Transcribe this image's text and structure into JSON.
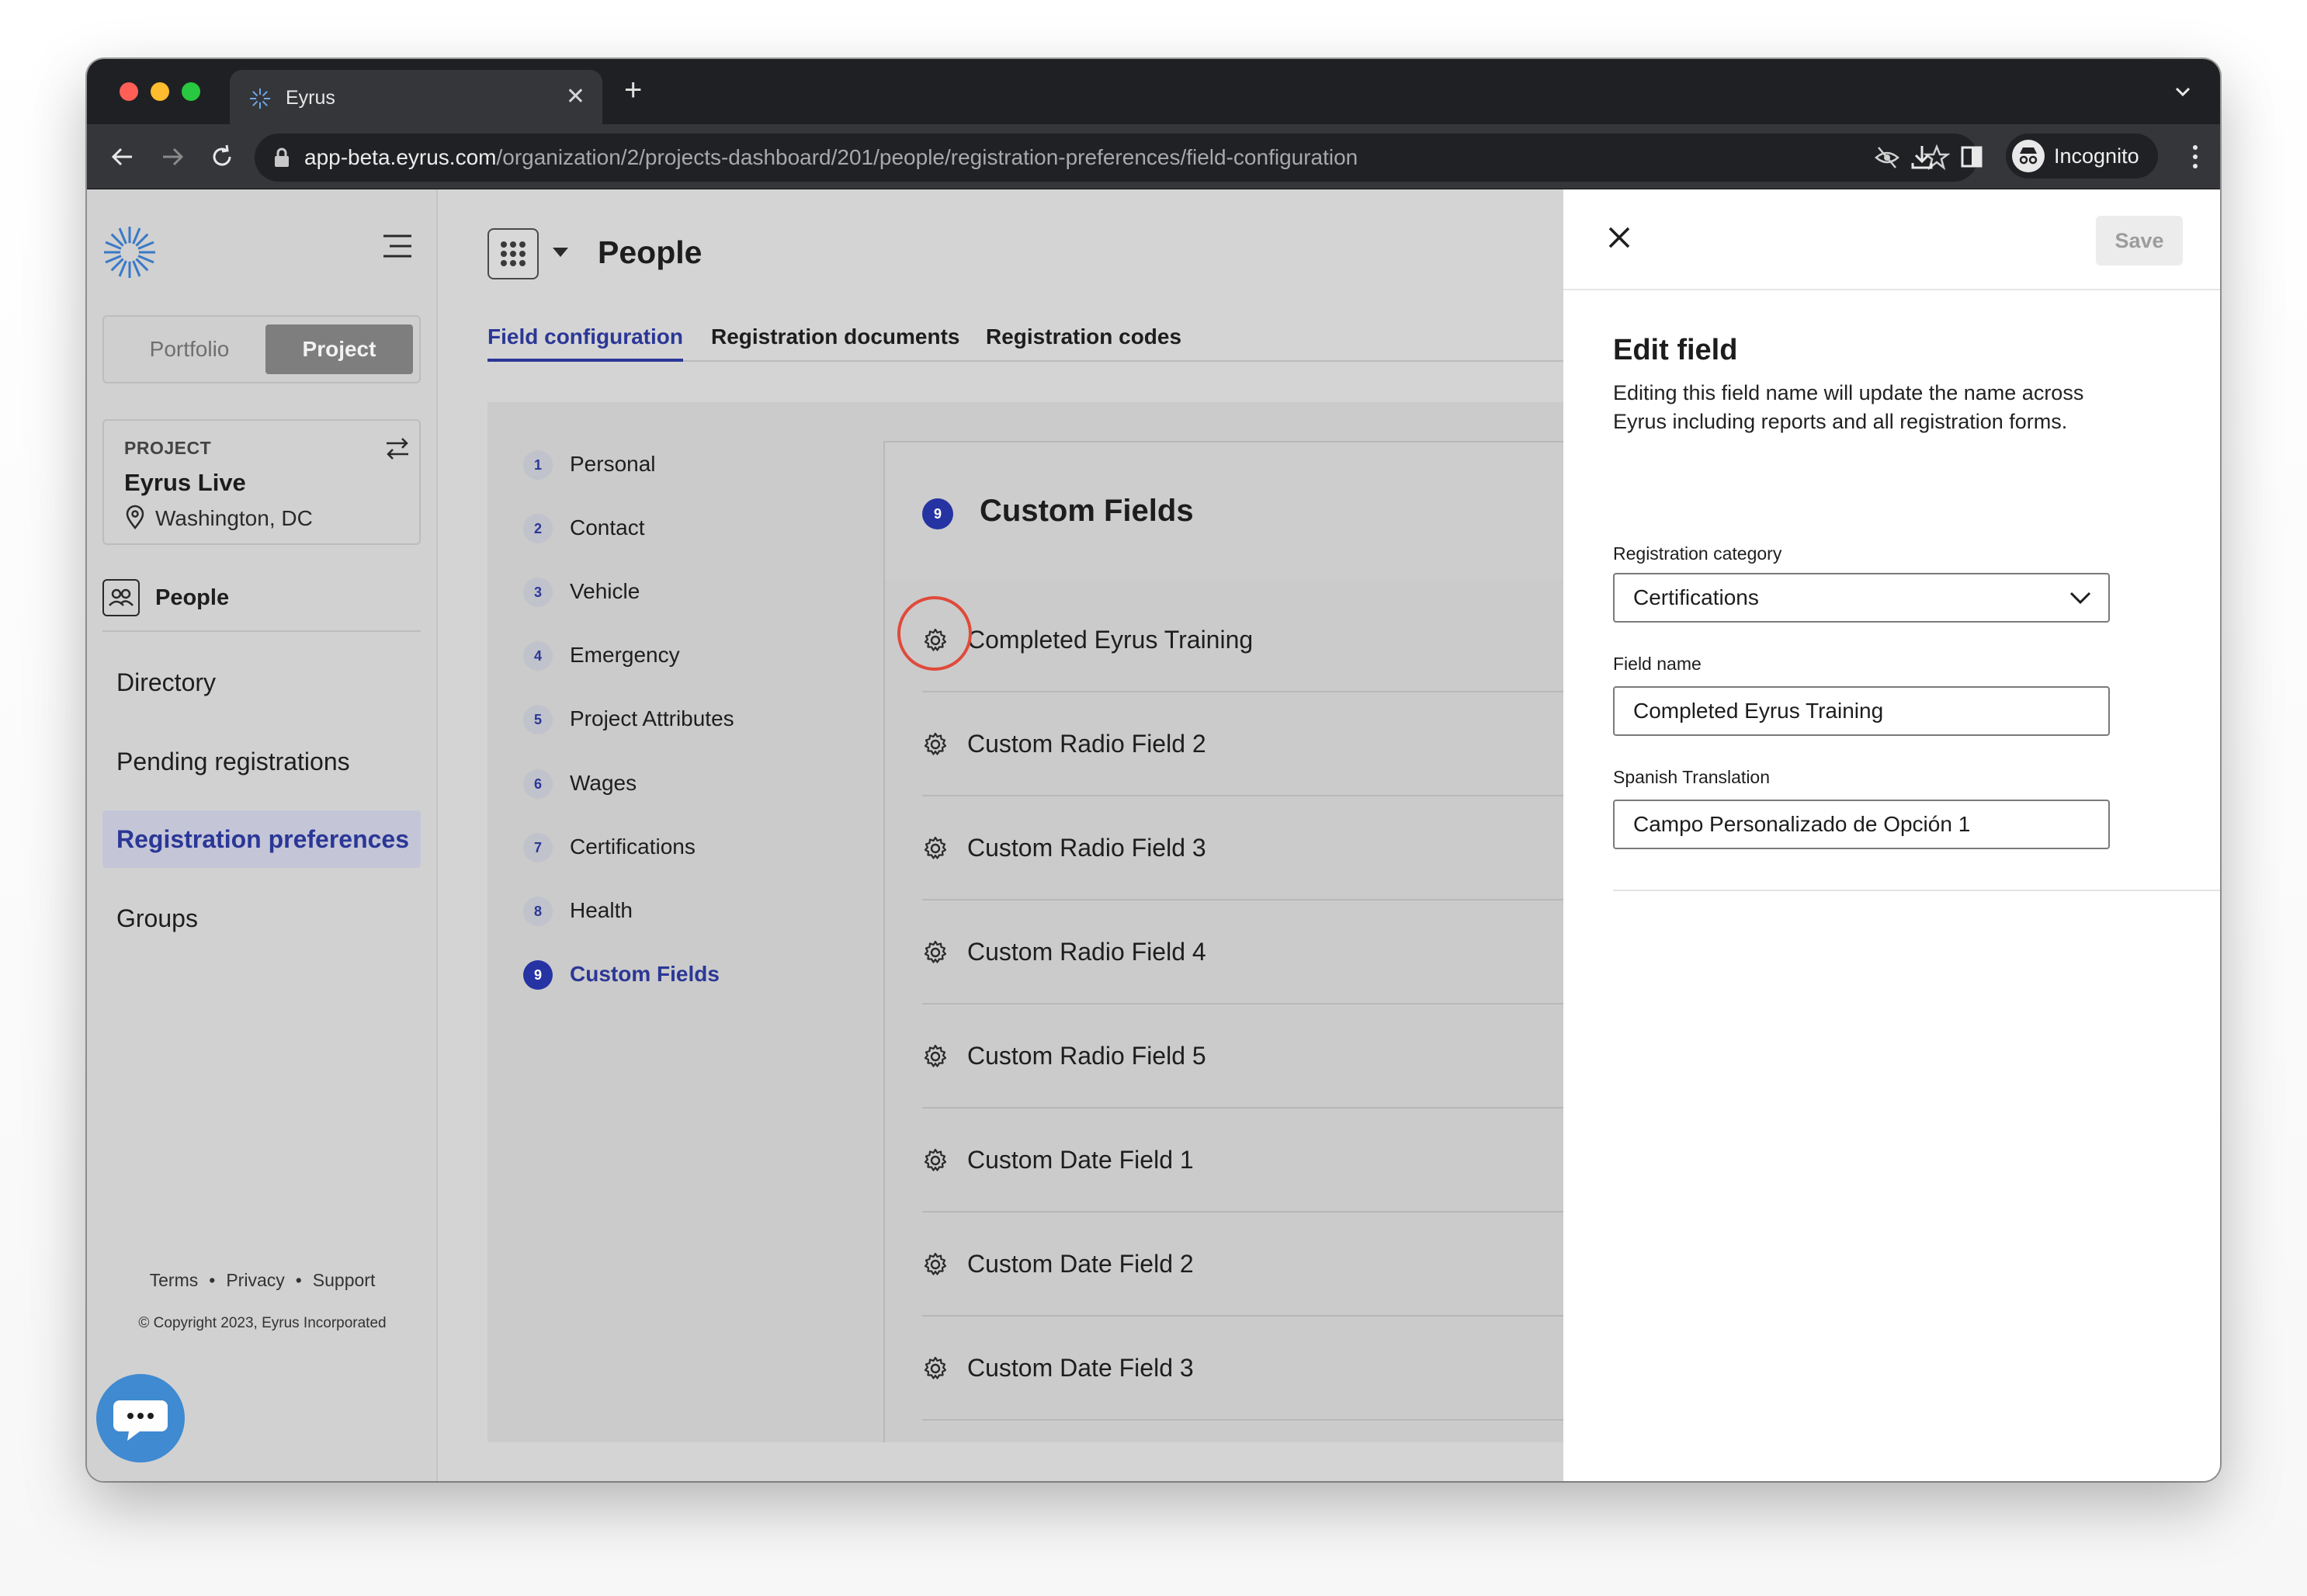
{
  "browser": {
    "tab_title": "Eyrus",
    "url_host": "app-beta.eyrus.com",
    "url_path": "/organization/2/projects-dashboard/201/people/registration-preferences/field-configuration",
    "profile_label": "Incognito",
    "icons": [
      "back-icon",
      "forward-icon",
      "reload-icon",
      "lock-icon",
      "eye-off-icon",
      "star-icon",
      "download-icon",
      "sidepanel-icon",
      "incognito-icon",
      "more-icon"
    ]
  },
  "sidebar": {
    "toggle": {
      "portfolio": "Portfolio",
      "project": "Project",
      "selected": "Project"
    },
    "project_card": {
      "kicker": "PROJECT",
      "name": "Eyrus Live",
      "location": "Washington, DC"
    },
    "section_label": "People",
    "nav": [
      {
        "label": "Directory",
        "active": false
      },
      {
        "label": "Pending registrations",
        "active": false
      },
      {
        "label": "Registration preferences",
        "active": true
      },
      {
        "label": "Groups",
        "active": false
      }
    ],
    "footer": {
      "terms": "Terms",
      "privacy": "Privacy",
      "support": "Support",
      "copyright": "© Copyright 2023, Eyrus Incorporated"
    }
  },
  "main": {
    "title": "People",
    "tabs": [
      {
        "label": "Field configuration",
        "active": true
      },
      {
        "label": "Registration documents",
        "active": false
      },
      {
        "label": "Registration codes",
        "active": false
      }
    ],
    "steps": [
      {
        "num": "1",
        "label": "Personal"
      },
      {
        "num": "2",
        "label": "Contact"
      },
      {
        "num": "3",
        "label": "Vehicle"
      },
      {
        "num": "4",
        "label": "Emergency"
      },
      {
        "num": "5",
        "label": "Project Attributes"
      },
      {
        "num": "6",
        "label": "Wages"
      },
      {
        "num": "7",
        "label": "Certifications"
      },
      {
        "num": "8",
        "label": "Health"
      },
      {
        "num": "9",
        "label": "Custom Fields",
        "active": true
      }
    ],
    "section": {
      "num": "9",
      "title": "Custom Fields"
    },
    "fields": [
      "Completed Eyrus Training",
      "Custom Radio Field 2",
      "Custom Radio Field 3",
      "Custom Radio Field 4",
      "Custom Radio Field 5",
      "Custom Date Field 1",
      "Custom Date Field 2",
      "Custom Date Field 3"
    ],
    "highlighted_field_index": 0
  },
  "drawer": {
    "save_label": "Save",
    "title": "Edit field",
    "description": "Editing this field name will update the name across Eyrus including reports and all registration forms.",
    "category_label": "Registration category",
    "category_value": "Certifications",
    "field_name_label": "Field name",
    "field_name_value": "Completed Eyrus Training",
    "translation_label": "Spanish Translation",
    "translation_value": "Campo Personalizado de Opción 1"
  },
  "colors": {
    "accent": "#2b3796",
    "highlight_ring": "#e04a3a",
    "chat_fab": "#3f8ad1"
  }
}
